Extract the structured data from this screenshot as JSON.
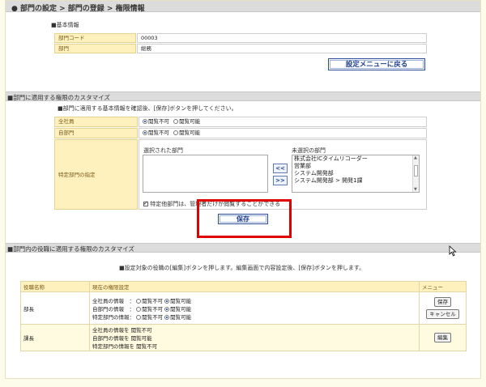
{
  "header": {
    "title": "● 部門の設定 > 部門の登録 > 権限情報"
  },
  "basic_info": {
    "heading": "■基本情報",
    "rows": [
      {
        "label": "部門コード",
        "value": "00003"
      },
      {
        "label": "部門",
        "value": "総務"
      }
    ],
    "back_button_label": "設定メニューに戻る"
  },
  "customize_section": {
    "title": "■部門に適用する権限のカスタマイズ",
    "instruction": "■部門に適用する基本情報を確認後、[保存]ボタンを押してください。",
    "rows": [
      {
        "label": "全社員",
        "opt1": "閲覧不可",
        "opt2": "閲覧可能"
      },
      {
        "label": "自部門",
        "opt1": "閲覧不可",
        "opt2": "閲覧可能"
      }
    ],
    "specific_label": "特定部門の指定",
    "selected_heading": "選択された部門",
    "unselected_heading": "未選択の部門",
    "add_arrow": "<<",
    "remove_arrow": ">>",
    "unselected_items": [
      "株式会社ICタイムリコーダー",
      "営業部",
      "システム開発部",
      "システム開発部 > 開発1課"
    ],
    "checkbox_label": "特定他部門は、管理者だけが閲覧することができる",
    "save_label": "保存"
  },
  "roles_section": {
    "title": "■部門内の役職に適用する権限のカスタマイズ",
    "instruction": "■設定対象の役職の[編集]ボタンを押します。編集画面で内容設定後、[保存]ボタンを押します。",
    "columns": [
      "役職名称",
      "現在の権限設定",
      "メニュー"
    ],
    "row1": {
      "name": "部長",
      "line1_label": "全社員の情報　：",
      "line2_label": "自部門の情報　：",
      "line3_label": "特定部門の情報：",
      "opt1": "閲覧不可",
      "opt2": "閲覧可能",
      "save": "保存",
      "cancel": "キャンセル"
    },
    "row2": {
      "name": "課長",
      "line1": "全社員の情報を 閲覧不可",
      "line2": "自部門の情報を 閲覧可能",
      "line3": "特定部門の情報を 閲覧不可",
      "edit": "編集"
    }
  }
}
